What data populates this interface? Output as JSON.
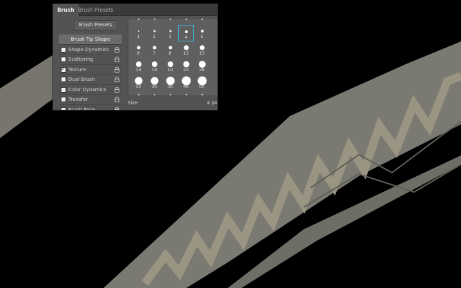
{
  "panel": {
    "tabs": [
      {
        "label": "Brush",
        "active": true
      },
      {
        "label": "Brush Presets",
        "active": false
      }
    ],
    "presets_button": "Brush Presets",
    "tip_shape_label": "Brush Tip Shape",
    "options": [
      {
        "label": "Shape Dynamics",
        "checked": false
      },
      {
        "label": "Scattering",
        "checked": false
      },
      {
        "label": "Texture",
        "checked": true
      },
      {
        "label": "Dual Brush",
        "checked": false
      },
      {
        "label": "Color Dynamics",
        "checked": false
      },
      {
        "label": "Transfer",
        "checked": false
      },
      {
        "label": "Brush Pose",
        "checked": false
      }
    ],
    "brush_sizes": [
      {
        "label": "1"
      },
      {
        "label": "2"
      },
      {
        "label": "3"
      },
      {
        "label": "4",
        "selected": true
      },
      {
        "label": "5"
      },
      {
        "label": "6"
      },
      {
        "label": "7"
      },
      {
        "label": "8"
      },
      {
        "label": "12"
      },
      {
        "label": "13"
      },
      {
        "label": "16"
      },
      {
        "label": "18"
      },
      {
        "label": "19"
      },
      {
        "label": "24"
      },
      {
        "label": "28"
      },
      {
        "label": "32"
      },
      {
        "label": "36"
      },
      {
        "label": "38"
      },
      {
        "label": "48"
      },
      {
        "label": "60"
      }
    ],
    "size_label": "Size",
    "size_value": "4 px"
  },
  "colors": {
    "canvas_bg": "#000000",
    "stroke": "#7b7a72",
    "zigzag": "#9a9482",
    "panel_bg": "#535353",
    "selection": "#3ab1d8"
  }
}
